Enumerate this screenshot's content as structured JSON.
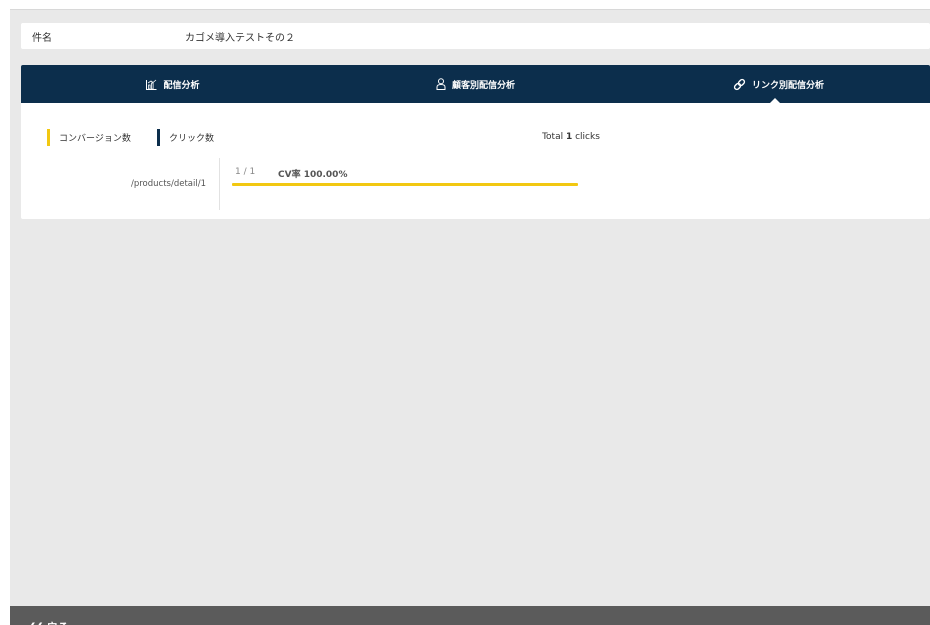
{
  "record": {
    "name_label": "件名",
    "name_value": "カゴメ導入テストその２"
  },
  "tabs": [
    {
      "label": "配信分析",
      "icon": "bar-chart-icon",
      "active": false
    },
    {
      "label": "顧客別配信分析",
      "icon": "person-icon",
      "active": false
    },
    {
      "label": "リンク別配信分析",
      "icon": "link-icon",
      "active": true
    }
  ],
  "legend": {
    "conversion_label": "コンバージョン数",
    "conversion_color": "#f2c811",
    "click_label": "クリック数",
    "click_color": "#0c2e4c"
  },
  "summary": {
    "total_prefix": "Total",
    "total_count": "1",
    "total_suffix": "clicks"
  },
  "links": [
    {
      "url": "/products/detail/1",
      "conversions": "1",
      "clicks": "1",
      "ratio_separator": "/",
      "cv_rate_label": "CV率",
      "cv_rate": "100.00%",
      "bar_fraction": 1.0
    }
  ],
  "footer": {
    "back_label": "戻る",
    "back_icon": "double-chevron-left-icon"
  },
  "colors": {
    "header_bg": "#0c2e4c",
    "page_bg": "#e9e9e9",
    "accent": "#f2c811",
    "footer_bg": "#5b5b5b"
  }
}
